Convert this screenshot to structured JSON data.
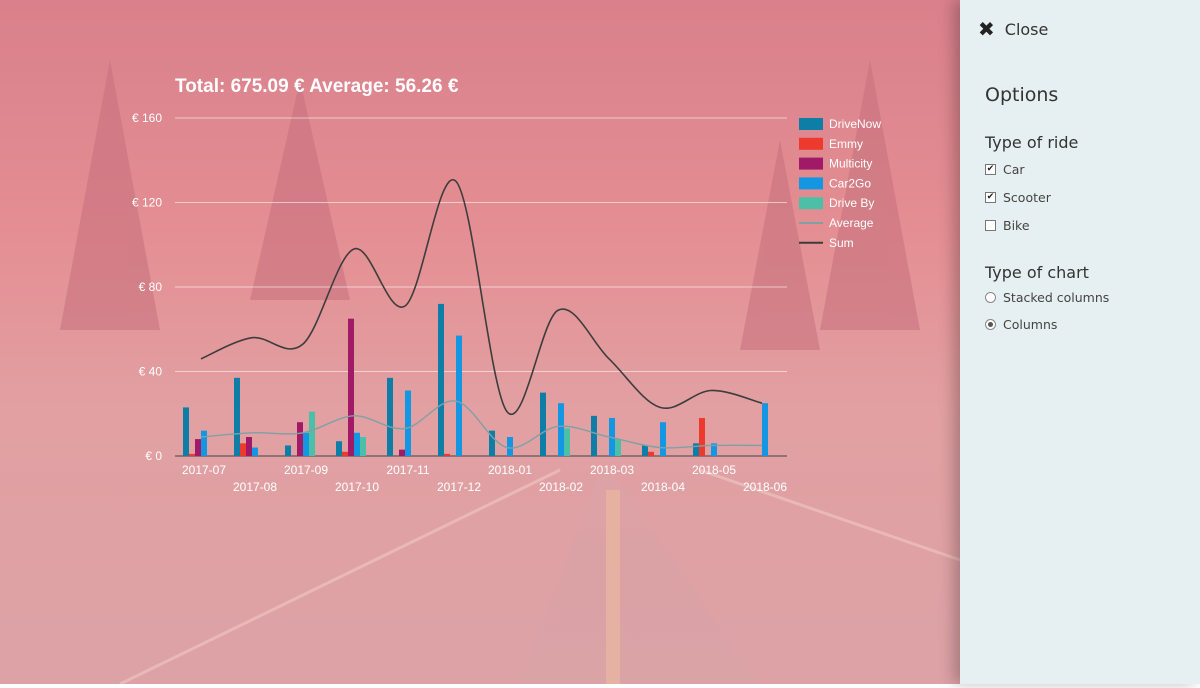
{
  "chart": {
    "title": "Total: 675.09 € Average: 56.26 €"
  },
  "chart_data": {
    "type": "bar",
    "categories": [
      "2017-07",
      "2017-08",
      "2017-09",
      "2017-10",
      "2017-11",
      "2017-12",
      "2018-01",
      "2018-02",
      "2018-03",
      "2018-04",
      "2018-05",
      "2018-06"
    ],
    "ylim": [
      0,
      160
    ],
    "yticks": [
      0,
      40,
      80,
      120,
      160
    ],
    "ytick_labels": [
      "€ 0",
      "€ 40",
      "€ 80",
      "€ 120",
      "€ 160"
    ],
    "grid": true,
    "legend_position": "top-right",
    "series": [
      {
        "name": "DriveNow",
        "kind": "bar",
        "color": "#0e7ea6",
        "values": [
          23,
          37,
          5,
          7,
          37,
          72,
          12,
          30,
          19,
          5,
          6,
          0
        ]
      },
      {
        "name": "Emmy",
        "kind": "bar",
        "color": "#ee3a2e",
        "values": [
          1,
          6,
          0,
          2,
          0,
          1,
          0,
          0,
          0,
          2,
          18,
          0
        ]
      },
      {
        "name": "Multicity",
        "kind": "bar",
        "color": "#a01a68",
        "values": [
          8,
          9,
          16,
          65,
          3,
          0,
          0,
          0,
          0,
          0,
          0,
          0
        ]
      },
      {
        "name": "Car2Go",
        "kind": "bar",
        "color": "#1497e2",
        "values": [
          12,
          4,
          11,
          11,
          31,
          57,
          9,
          25,
          18,
          16,
          6,
          25
        ]
      },
      {
        "name": "Drive By",
        "kind": "bar",
        "color": "#4cc0a6",
        "values": [
          0,
          0,
          21,
          9,
          0,
          0,
          0,
          13,
          8,
          0,
          0,
          0
        ]
      },
      {
        "name": "Average",
        "kind": "line",
        "color": "#7fa1a6",
        "values": [
          9,
          11,
          11,
          19,
          13,
          26,
          4,
          14,
          9,
          4,
          5,
          5
        ]
      },
      {
        "name": "Sum",
        "kind": "line",
        "color": "#3d3d3d",
        "values": [
          46,
          56,
          53,
          98,
          71,
          130,
          21,
          69,
          46,
          23,
          31,
          25
        ]
      }
    ]
  },
  "sidebar": {
    "close_label": "Close",
    "options_title": "Options",
    "ride_type_title": "Type of ride",
    "ride_types": [
      {
        "label": "Car",
        "checked": true
      },
      {
        "label": "Scooter",
        "checked": true
      },
      {
        "label": "Bike",
        "checked": false
      }
    ],
    "chart_type_title": "Type of chart",
    "chart_types": [
      {
        "label": "Stacked columns",
        "selected": false
      },
      {
        "label": "Columns",
        "selected": true
      }
    ]
  }
}
